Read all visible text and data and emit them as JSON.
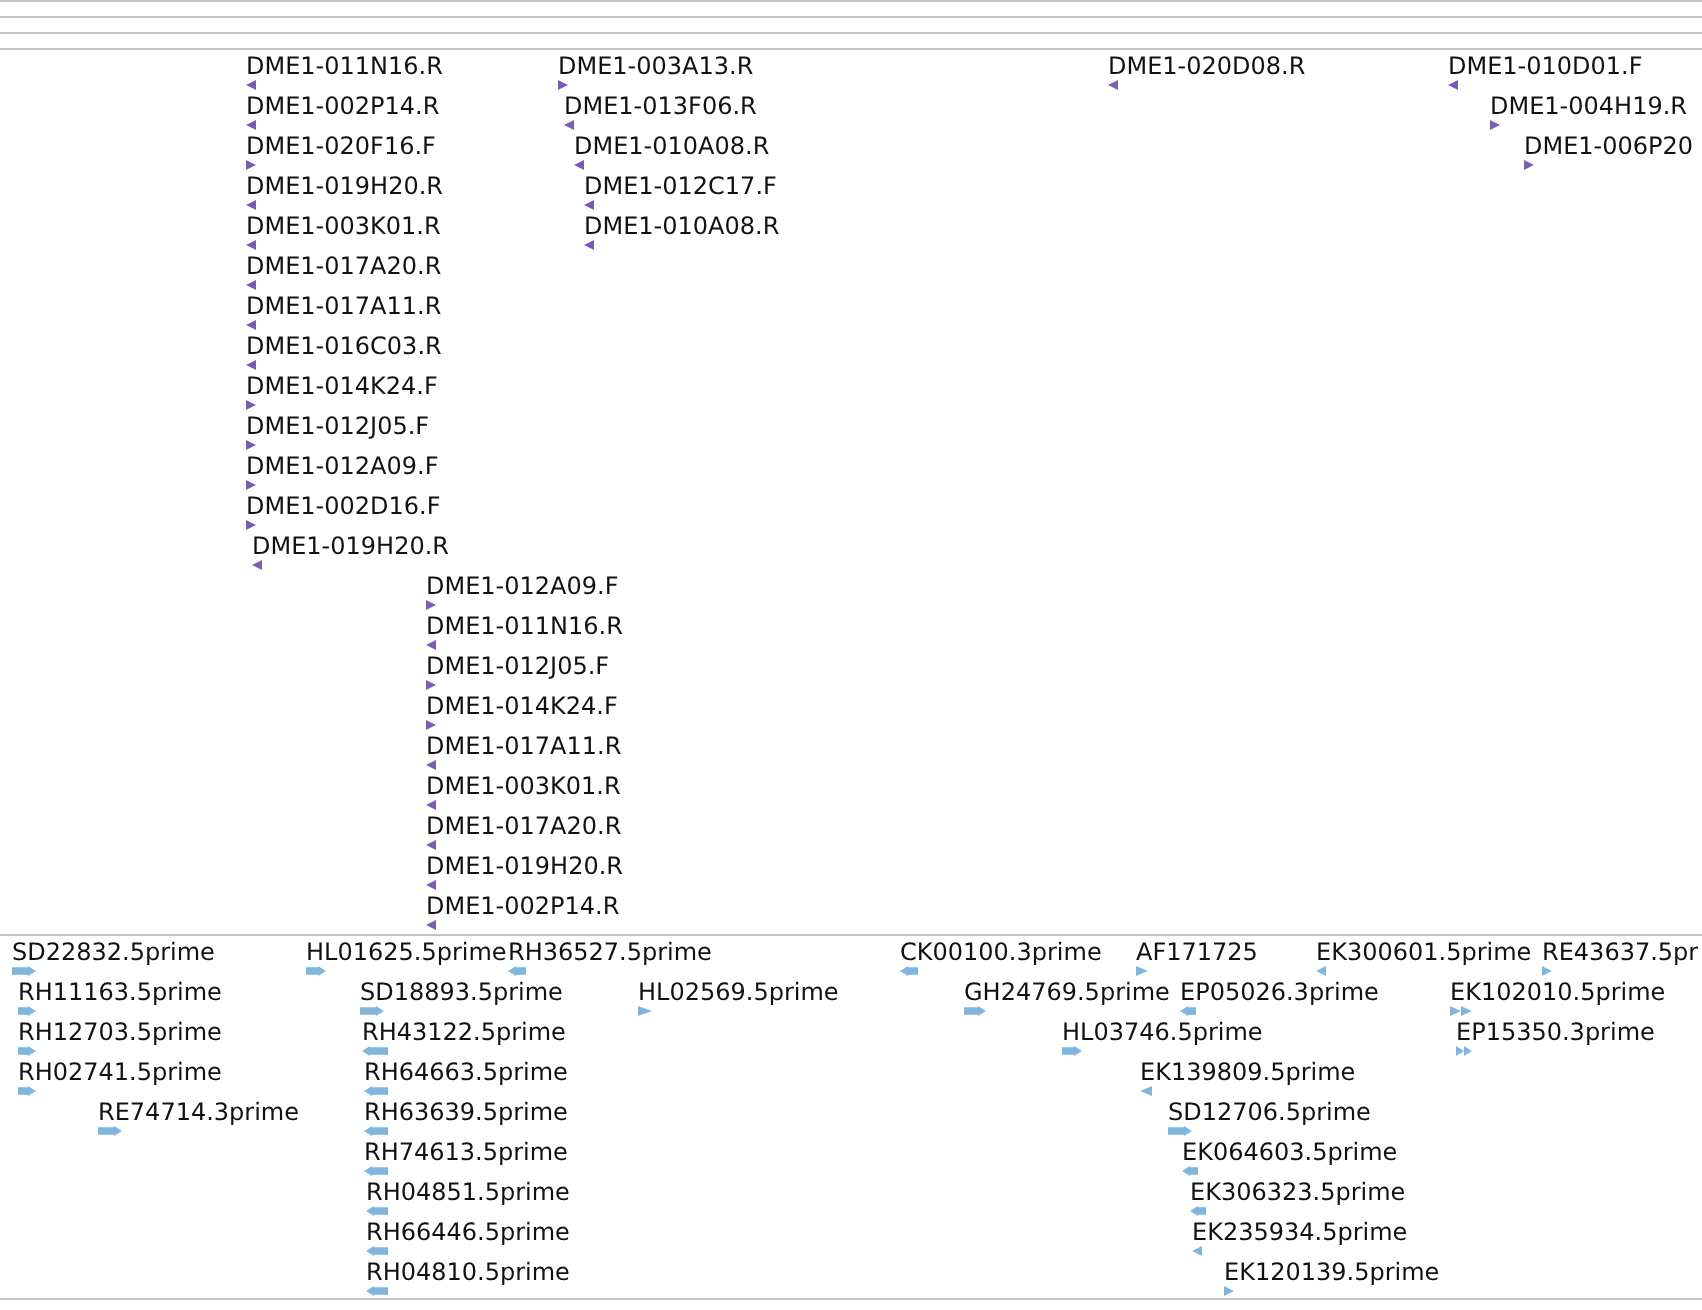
{
  "tracks": [
    {
      "color": "#7b5cb4",
      "features": [
        {
          "label": "DME1-011N16.R",
          "reverse": true
        },
        {
          "label": "DME1-003A13.R",
          "reverse": false
        },
        {
          "label": "DME1-020D08.R",
          "reverse": true
        },
        {
          "label": "DME1-010D01.F",
          "reverse": true
        },
        {
          "label": "DME1-002P14.R",
          "reverse": true
        },
        {
          "label": "DME1-013F06.R",
          "reverse": true
        },
        {
          "label": "DME1-004H19.R",
          "reverse": false
        },
        {
          "label": "DME1-020F16.F",
          "reverse": false
        },
        {
          "label": "DME1-010A08.R",
          "reverse": true
        },
        {
          "label": "DME1-006P20",
          "reverse": false
        },
        {
          "label": "DME1-019H20.R",
          "reverse": true
        },
        {
          "label": "DME1-012C17.F",
          "reverse": true
        },
        {
          "label": "DME1-003K01.R",
          "reverse": true
        },
        {
          "label": "DME1-010A08.R",
          "reverse": true
        },
        {
          "label": "DME1-017A20.R",
          "reverse": true
        },
        {
          "label": "DME1-017A11.R",
          "reverse": true
        },
        {
          "label": "DME1-016C03.R",
          "reverse": true
        },
        {
          "label": "DME1-014K24.F",
          "reverse": false
        },
        {
          "label": "DME1-012J05.F",
          "reverse": false
        },
        {
          "label": "DME1-012A09.F",
          "reverse": false
        },
        {
          "label": "DME1-002D16.F",
          "reverse": false
        },
        {
          "label": "DME1-019H20.R",
          "reverse": true
        },
        {
          "label": "DME1-012A09.F",
          "reverse": false
        },
        {
          "label": "DME1-011N16.R",
          "reverse": true
        },
        {
          "label": "DME1-012J05.F",
          "reverse": false
        },
        {
          "label": "DME1-014K24.F",
          "reverse": false
        },
        {
          "label": "DME1-017A11.R",
          "reverse": true
        },
        {
          "label": "DME1-003K01.R",
          "reverse": true
        },
        {
          "label": "DME1-017A20.R",
          "reverse": true
        },
        {
          "label": "DME1-019H20.R",
          "reverse": true
        },
        {
          "label": "DME1-002P14.R",
          "reverse": true
        }
      ]
    },
    {
      "color": "#80b6de",
      "features": [
        {
          "label": "SD22832.5prime",
          "reverse": false,
          "kind": "arrow"
        },
        {
          "label": "HL01625.5prime",
          "reverse": false,
          "kind": "arrow"
        },
        {
          "label": "RH36527.5prime",
          "reverse": true,
          "kind": "arrow"
        },
        {
          "label": "CK00100.3prime",
          "reverse": true,
          "kind": "arrow"
        },
        {
          "label": "AF171725",
          "reverse": false,
          "kind": "arrow"
        },
        {
          "label": "EK300601.5prime",
          "reverse": true,
          "kind": "arrow"
        },
        {
          "label": "RE43637.5pr",
          "reverse": false,
          "kind": "arrow"
        },
        {
          "label": "RH11163.5prime",
          "reverse": false,
          "kind": "arrow"
        },
        {
          "label": "SD18893.5prime",
          "reverse": false,
          "kind": "arrow"
        },
        {
          "label": "HL02569.5prime",
          "reverse": false,
          "kind": "arrow"
        },
        {
          "label": "GH24769.5prime",
          "reverse": false,
          "kind": "arrow"
        },
        {
          "label": "EP05026.3prime",
          "reverse": true,
          "kind": "arrow"
        },
        {
          "label": "EK102010.5prime",
          "reverse": false,
          "kind": "double"
        },
        {
          "label": "RH12703.5prime",
          "reverse": false,
          "kind": "arrow"
        },
        {
          "label": "RH43122.5prime",
          "reverse": true,
          "kind": "arrow"
        },
        {
          "label": "HL03746.5prime",
          "reverse": false,
          "kind": "arrow"
        },
        {
          "label": "EP15350.3prime",
          "reverse": false,
          "kind": "double"
        },
        {
          "label": "RH02741.5prime",
          "reverse": false,
          "kind": "arrow"
        },
        {
          "label": "RH64663.5prime",
          "reverse": true,
          "kind": "arrow"
        },
        {
          "label": "EK139809.5prime",
          "reverse": true,
          "kind": "arrow"
        },
        {
          "label": "RE74714.3prime",
          "reverse": false,
          "kind": "arrow"
        },
        {
          "label": "RH63639.5prime",
          "reverse": true,
          "kind": "arrow"
        },
        {
          "label": "SD12706.5prime",
          "reverse": false,
          "kind": "arrow"
        },
        {
          "label": "RH74613.5prime",
          "reverse": true,
          "kind": "arrow"
        },
        {
          "label": "EK064603.5prime",
          "reverse": true,
          "kind": "arrow"
        },
        {
          "label": "RH04851.5prime",
          "reverse": true,
          "kind": "arrow"
        },
        {
          "label": "EK306323.5prime",
          "reverse": true,
          "kind": "arrow"
        },
        {
          "label": "RH66446.5prime",
          "reverse": true,
          "kind": "arrow"
        },
        {
          "label": "EK235934.5prime",
          "reverse": true,
          "kind": "arrow"
        },
        {
          "label": "RH04810.5prime",
          "reverse": true,
          "kind": "arrow"
        },
        {
          "label": "EK120139.5prime",
          "reverse": false,
          "kind": "arrow"
        }
      ]
    }
  ]
}
